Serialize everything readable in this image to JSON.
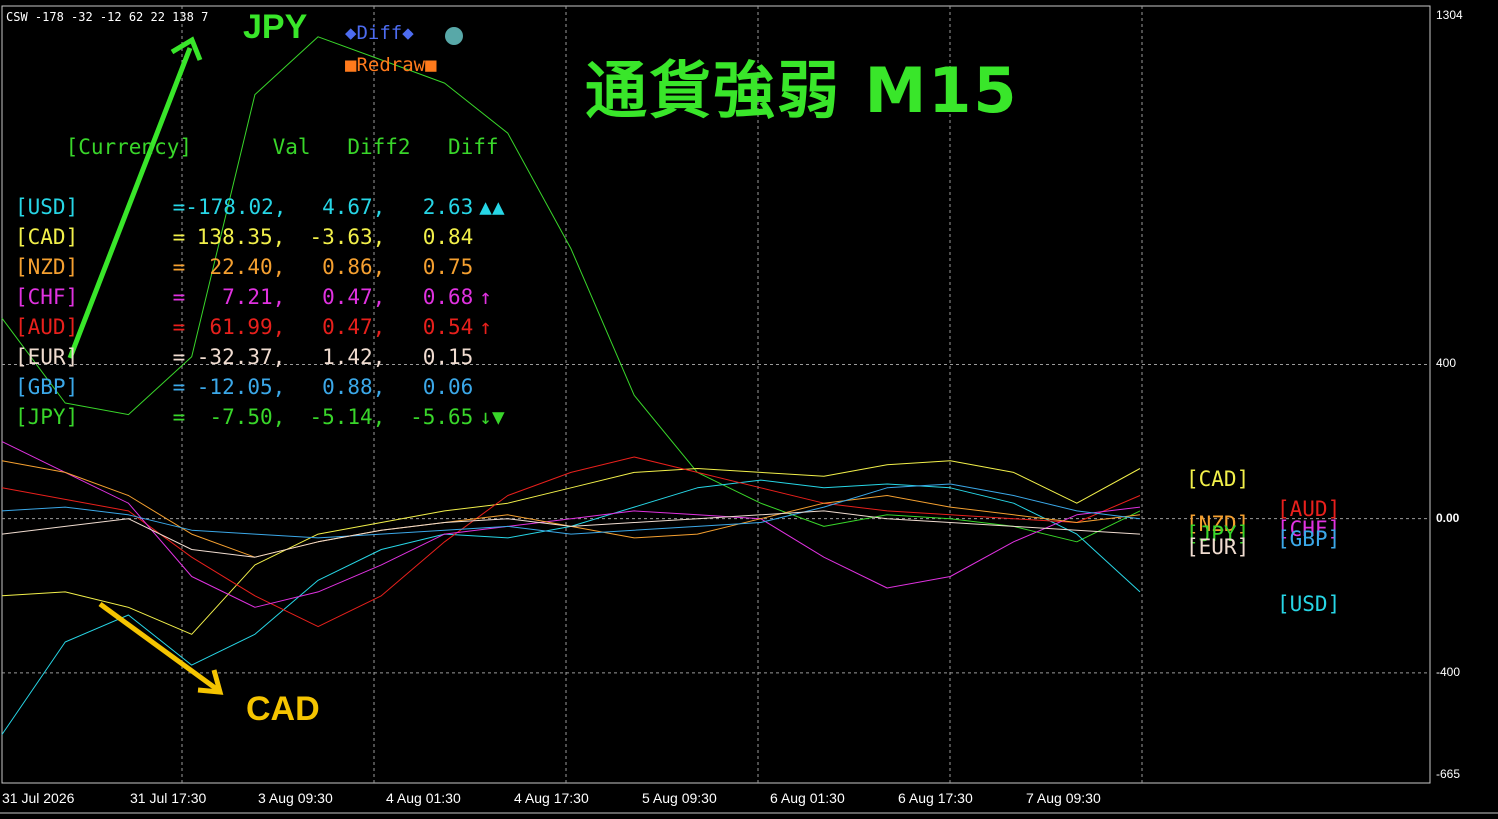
{
  "window": {
    "caption": "CSW -178 -32 -12 62 22 138 7"
  },
  "title": "通貨強弱  M15",
  "annotations": {
    "jpy_label": "JPY",
    "cad_label": "CAD"
  },
  "buttons": {
    "diff": "◆Diff◆",
    "redraw": "■Redraw■"
  },
  "table": {
    "headers": [
      "[Currency]",
      "Val",
      "Diff2",
      "Diff"
    ],
    "rows": [
      {
        "currency": "[USD]",
        "eq": "=",
        "val": "-178.02,",
        "diff2": "4.67,",
        "diff": "2.63",
        "mark": "▲▲",
        "color": "#27d6e6"
      },
      {
        "currency": "[CAD]",
        "eq": "=",
        "val": "138.35,",
        "diff2": "-3.63,",
        "diff": "0.84",
        "mark": "",
        "color": "#f2f04a"
      },
      {
        "currency": "[NZD]",
        "eq": "=",
        "val": "22.40,",
        "diff2": "0.86,",
        "diff": "0.75",
        "mark": "",
        "color": "#f5a030"
      },
      {
        "currency": "[CHF]",
        "eq": "=",
        "val": "7.21,",
        "diff2": "0.47,",
        "diff": "0.68",
        "mark": "↑",
        "color": "#e032e0"
      },
      {
        "currency": "[AUD]",
        "eq": "=",
        "val": "61.99,",
        "diff2": "0.47,",
        "diff": "0.54",
        "mark": "↑",
        "color": "#e8201c"
      },
      {
        "currency": "[EUR]",
        "eq": "=",
        "val": "-32.37,",
        "diff2": "1.42,",
        "diff": "0.15",
        "mark": "",
        "color": "#f0dcd0"
      },
      {
        "currency": "[GBP]",
        "eq": "=",
        "val": "-12.05,",
        "diff2": "0.88,",
        "diff": "0.06",
        "mark": "",
        "color": "#3ba8e8"
      },
      {
        "currency": "[JPY]",
        "eq": "=",
        "val": "-7.50,",
        "diff2": "-5.14,",
        "diff": "-5.65",
        "mark": "↓▼",
        "color": "#39d62a"
      }
    ]
  },
  "y_axis": {
    "labels": [
      "1304",
      "400",
      "0.00",
      "-400",
      "-665"
    ]
  },
  "x_axis": {
    "labels": [
      "31 Jul 2026",
      "31 Jul 17:30",
      "3 Aug 09:30",
      "4 Aug 01:30",
      "4 Aug 17:30",
      "5 Aug 09:30",
      "6 Aug 01:30",
      "6 Aug 17:30",
      "7 Aug 09:30"
    ]
  },
  "legend_tags": [
    {
      "text": "[CAD]",
      "color": "#f2f04a"
    },
    {
      "text": "[AUD]",
      "color": "#e8201c"
    },
    {
      "text": "[NZD]",
      "color": "#f5a030"
    },
    {
      "text": "[JPY]",
      "color": "#39d62a"
    },
    {
      "text": "[CHF]",
      "color": "#e032e0"
    },
    {
      "text": "[EUR]",
      "color": "#f0dcd0"
    },
    {
      "text": "[GBP]",
      "color": "#3ba8e8"
    },
    {
      "text": "[USD]",
      "color": "#27d6e6"
    }
  ],
  "chart_data": {
    "type": "line",
    "x": [
      0,
      1,
      2,
      3,
      4,
      5,
      6,
      7,
      8,
      9,
      10,
      11,
      12,
      13,
      14,
      15,
      16,
      17,
      18
    ],
    "y_range": [
      -665,
      1304
    ],
    "series": [
      {
        "color": "#39d62a",
        "values": [
          520,
          300,
          270,
          420,
          1100,
          1250,
          1190,
          1130,
          1000,
          700,
          320,
          120,
          40,
          -20,
          10,
          0,
          -20,
          -60,
          20
        ]
      },
      {
        "color": "#f2f04a",
        "values": [
          -200,
          -190,
          -230,
          -300,
          -120,
          -40,
          -10,
          20,
          40,
          80,
          120,
          130,
          120,
          110,
          140,
          150,
          120,
          40,
          130
        ]
      },
      {
        "color": "#27d6e6",
        "values": [
          -560,
          -320,
          -250,
          -380,
          -300,
          -160,
          -80,
          -40,
          -50,
          -20,
          30,
          80,
          100,
          80,
          90,
          80,
          40,
          -40,
          -190
        ]
      },
      {
        "color": "#e8201c",
        "values": [
          80,
          50,
          20,
          -100,
          -200,
          -280,
          -200,
          -60,
          60,
          120,
          160,
          120,
          80,
          40,
          20,
          10,
          0,
          -10,
          60
        ]
      },
      {
        "color": "#e032e0",
        "values": [
          200,
          120,
          40,
          -150,
          -230,
          -190,
          -120,
          -40,
          -20,
          0,
          20,
          10,
          0,
          -100,
          -180,
          -150,
          -60,
          10,
          30
        ]
      },
      {
        "color": "#f5a030",
        "values": [
          150,
          120,
          60,
          -40,
          -100,
          -60,
          -30,
          -10,
          10,
          -20,
          -50,
          -40,
          0,
          40,
          60,
          30,
          10,
          -10,
          10
        ]
      },
      {
        "color": "#3ba8e8",
        "values": [
          20,
          30,
          10,
          -30,
          -40,
          -50,
          -40,
          -30,
          -20,
          -40,
          -30,
          -20,
          -10,
          30,
          80,
          90,
          60,
          20,
          0
        ]
      },
      {
        "color": "#f0dcd0",
        "values": [
          -40,
          -20,
          0,
          -80,
          -100,
          -60,
          -30,
          -10,
          0,
          -20,
          -10,
          0,
          10,
          20,
          0,
          -10,
          -20,
          -30,
          -40
        ]
      }
    ]
  }
}
